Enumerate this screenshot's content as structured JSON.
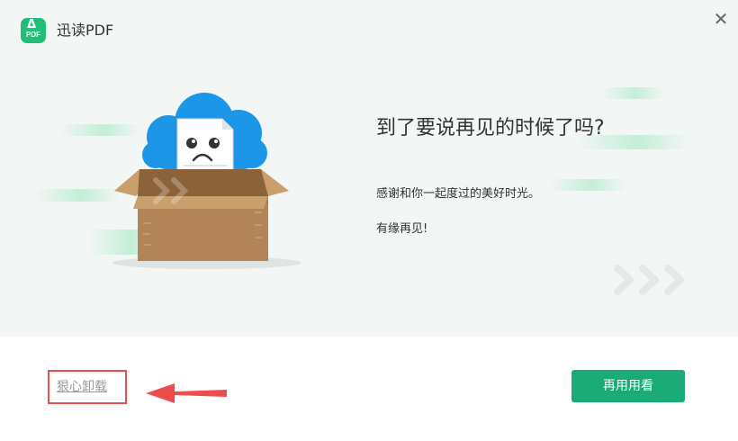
{
  "window": {
    "title": "迅读PDF",
    "logo_text": "PDF",
    "close_glyph": "✕"
  },
  "illustration": {
    "name": "sad-document-in-box"
  },
  "message": {
    "heading": "到了要说再见的时候了吗?",
    "line1": "感谢和你一起度过的美好时光。",
    "line2": "有缘再见!"
  },
  "footer": {
    "uninstall_label": "狠心卸载",
    "continue_label": "再用用看"
  },
  "colors": {
    "brand_green": "#1bab76",
    "logo_green": "#1fbf7a",
    "annotation_red": "#ee4d4d",
    "top_background": "#f2f6f5"
  },
  "icons": [
    "pdf-logo-icon",
    "close-icon",
    "box-cloud-illustration",
    "chevrons-icon",
    "annotation-arrow-icon"
  ]
}
